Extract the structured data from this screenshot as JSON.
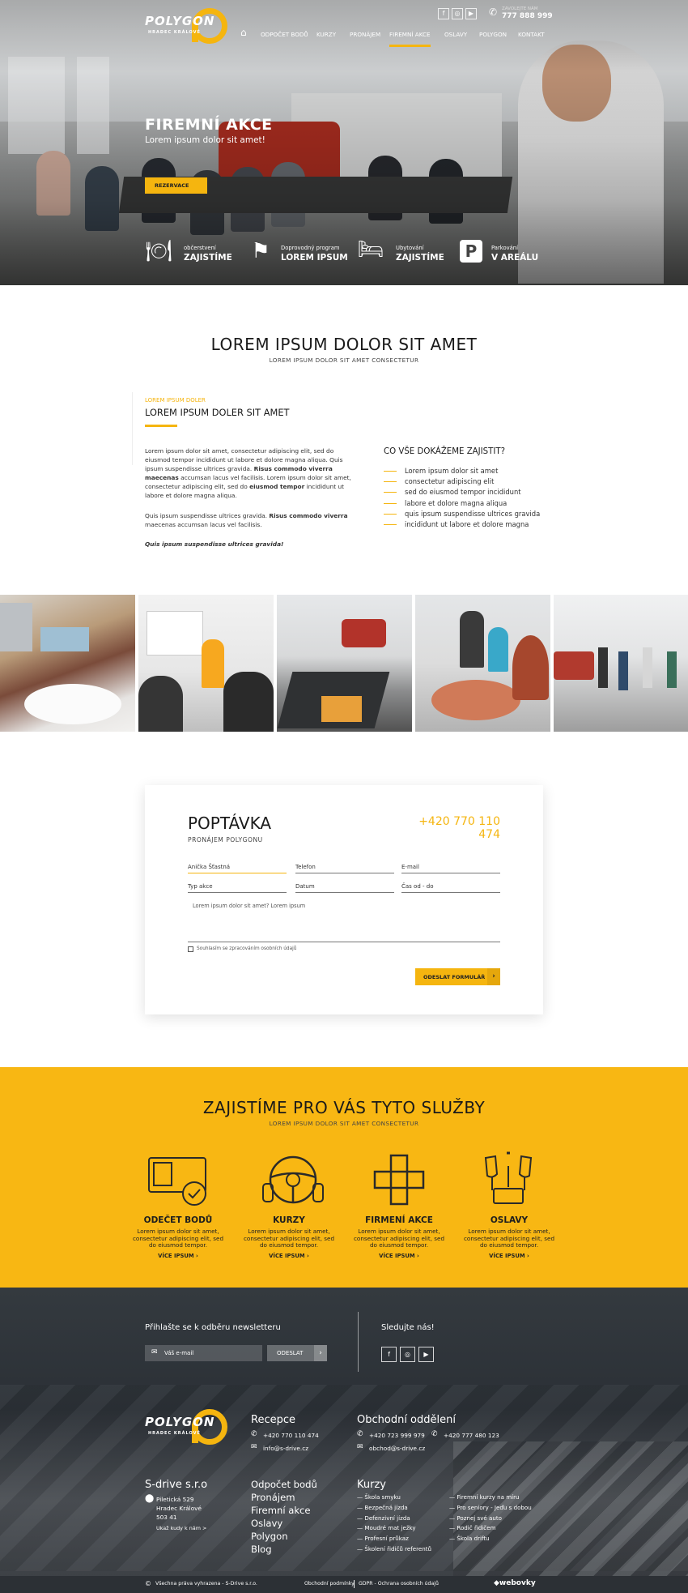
{
  "header": {
    "logo_word": "POLYGON",
    "logo_sub": "HRADEC KRÁLOVÉ",
    "call_label": "ZAVOLEJTE NÁM",
    "phone": "777 888 999",
    "nav": [
      "ODPOČET BODŮ",
      "KURZY",
      "PRONÁJEM",
      "FIREMNÍ AKCE",
      "OSLAVY",
      "POLYGON",
      "KONTAKT"
    ],
    "active": "FIREMNÍ AKCE",
    "social": [
      "facebook-icon",
      "instagram-icon",
      "youtube-icon"
    ]
  },
  "hero": {
    "title": "FIREMNÍ AKCE",
    "subtitle": "Lorem ipsum dolor sit amet!",
    "button": "REZERVACE",
    "features": [
      {
        "icon": "cutlery-icon",
        "small": "občerstvení",
        "big": "ZAJISTÍME"
      },
      {
        "icon": "flags-icon",
        "small": "Doprovodný program",
        "big": "LOREM IPSUM"
      },
      {
        "icon": "bed-icon",
        "small": "Ubytování",
        "big": "ZAJISTÍME"
      },
      {
        "icon": "parking-icon",
        "small": "Parkování",
        "big": "V AREÁLU"
      }
    ]
  },
  "intro": {
    "title": "LOREM IPSUM DOLOR SIT AMET",
    "subtitle": "LOREM IPSUM DOLOR SIT AMET CONSECTETUR",
    "kicker": "LOREM IPSUM DOLER",
    "heading": "LOREM IPSUM DOLER SIT AMET",
    "p1a": "Lorem ipsum dolor sit amet, consectetur adipiscing elit, sed do eiusmod tempor incididunt ut labore et dolore magna aliqua. Quis ipsum suspendisse ultrices gravida. ",
    "p1b": "Risus commodo viverra maecenas",
    "p1c": " accumsan lacus vel facilisis. Lorem ipsum dolor sit amet, consectetur adipiscing elit, sed do ",
    "p1d": "eiusmod tempor",
    "p1e": " incididunt ut labore et dolore magna aliqua.",
    "p2a": "Quis ipsum suspendisse ultrices gravida. ",
    "p2b": "Risus commodo viverra",
    "p2c": " maecenas accumsan lacus vel facilisis.",
    "p3": "Quis ipsum suspendisse ultrices gravida!",
    "list_title": "CO VŠE DOKÁŽEME ZAJISTIT?",
    "list": [
      "Lorem ipsum dolor sit amet",
      "consectetur adipiscing elit",
      "sed do eiusmod tempor incididunt",
      "labore et dolore magna aliqua",
      "quis ipsum suspendisse ultrices gravida",
      "incididunt ut labore et dolore magna"
    ]
  },
  "form": {
    "title": "POPTÁVKA",
    "subtitle": "PRONÁJEM POLYGONU",
    "phone": "+420 770 110 474",
    "name_value": "Anička Šťastná",
    "phone_ph": "Telefon",
    "email_ph": "E-mail",
    "type_ph": "Typ akce",
    "date_ph": "Datum",
    "time_ph": "Čas od - do",
    "message": "Lorem ipsum dolor sit amet? Lorem ipsum",
    "consent": "Souhlasím se zpracováním osobních údajů",
    "submit": "ODESLAT FORMULÁŘ"
  },
  "services": {
    "title": "ZAJISTÍME PRO VÁS TYTO SLUŽBY",
    "subtitle": "LOREM IPSUM DOLOR SIT AMET CONSECTETUR",
    "items": [
      {
        "icon": "license-icon",
        "title": "ODEČET BODŮ",
        "text": "Lorem ipsum dolor sit amet, consectetur adipiscing elit, sed do eiusmod tempor.",
        "link": "VÍCE IPSUM"
      },
      {
        "icon": "steering-wheel-icon",
        "title": "KURZY",
        "text": "Lorem ipsum dolor sit amet, consectetur adipiscing elit, sed do eiusmod tempor.",
        "link": "VÍCE IPSUM"
      },
      {
        "icon": "hands-icon",
        "title": "FIRMENÍ AKCE",
        "text": "Lorem ipsum dolor sit amet, consectetur adipiscing elit, sed do eiusmod tempor.",
        "link": "VÍCE IPSUM"
      },
      {
        "icon": "champagne-cake-icon",
        "title": "OSLAVY",
        "text": "Lorem ipsum dolor sit amet, consectetur adipiscing elit, sed do eiusmod tempor.",
        "link": "VÍCE IPSUM"
      }
    ]
  },
  "newsletter": {
    "title": "Přihlašte se k odběru newsletteru",
    "placeholder": "Váš e-mail",
    "button": "ODESLAT",
    "follow": "Sledujte nás!"
  },
  "footer": {
    "reception_title": "Recepce",
    "reception_phone": "+420 770 110 474",
    "reception_email": "info@s-drive.cz",
    "sales_title": "Obchodní oddělení",
    "sales_phone1": "+420 723 999 979",
    "sales_phone2": "+420 777 480 123",
    "sales_email": "obchod@s-drive.cz",
    "company": "S-drive s.r.o",
    "address": [
      "Piletická 529",
      "Hradec Králové",
      "503 41"
    ],
    "directions": "Ukaž kudy k nám >",
    "menu": [
      "Odpočet bodů",
      "Pronájem",
      "Firemní akce",
      "Oslavy",
      "Polygon",
      "Blog"
    ],
    "courses_title": "Kurzy",
    "courses_left": [
      "Škola smyku",
      "Bezpečná jízda",
      "Defenzivní jízda",
      "Moudré mat ježky",
      "Profesní průkaz",
      "Školení řidičů referentů"
    ],
    "courses_right": [
      "Firemní kurzy na míru",
      "Pro seniory - Jeďu s dobou",
      "Poznej své auto",
      "Rodič řidičem",
      "Škola driftu"
    ],
    "copyright": "Všechna práva vyhrazena - S-Drive s.r.o.",
    "terms": "Obchodní podmínky",
    "gdpr": "GDPR - Ochrana osobních údajů",
    "credit": "webovky"
  },
  "colors": {
    "accent": "#f5b50f",
    "dark": "#2e3338"
  }
}
